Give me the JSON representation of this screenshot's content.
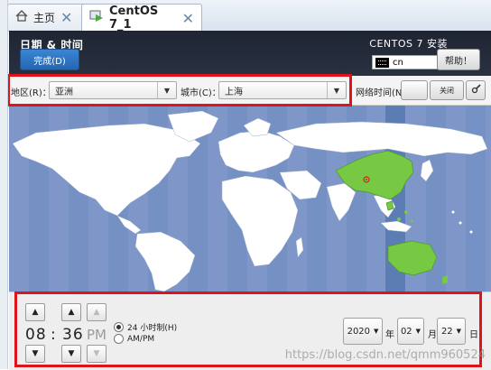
{
  "host": {
    "tabs": [
      {
        "label": "主页"
      },
      {
        "label": "CentOS 7_1"
      }
    ]
  },
  "installer": {
    "title": "日期 & 时间",
    "done_label": "完成(D)",
    "product": "CENTOS 7 安装",
    "keyboard_layout": "cn",
    "help_label": "帮助！"
  },
  "region": {
    "region_label": "地区(R)：",
    "region_value": "亚洲",
    "city_label": "城市(C)：",
    "city_value": "上海",
    "network_time_label": "网络时间(N)",
    "network_time_button": "关闭"
  },
  "time": {
    "hours": "08",
    "separator": ":",
    "minutes": "36",
    "ampm": "PM",
    "format_24h_label": "24 小时制(H)",
    "format_ampm_label": "AM/PM",
    "format_selected": "24h",
    "year": "2020",
    "year_label": "年",
    "month": "02",
    "month_label": "月",
    "day": "22",
    "day_label": "日"
  },
  "watermark": "https://blog.csdn.net/qmm960524",
  "colors": {
    "highlight": "#e0131b",
    "ocean": "#7e97c8",
    "selected_zone": "#5b7db3",
    "selected_country": "#77c842",
    "accent": "#2f78c8"
  }
}
